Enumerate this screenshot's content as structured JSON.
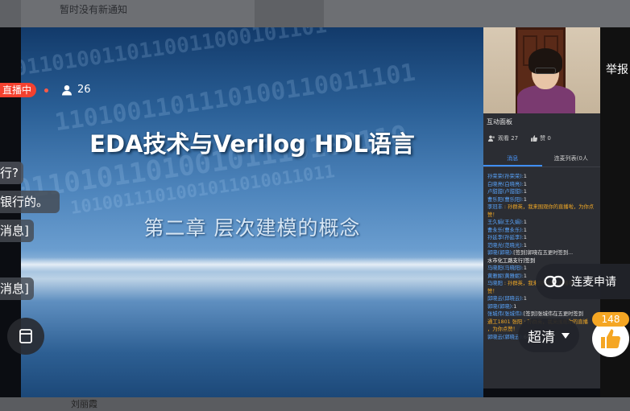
{
  "background": {
    "notice": "暂时没有新通知",
    "bottom_user": "刘丽霞"
  },
  "slide": {
    "title": "EDA技术与Verilog HDL语言",
    "subtitle": "第二章  层次建模的概念"
  },
  "live": {
    "status": "直播中",
    "viewers": "26"
  },
  "chat_bubbles": [
    "行?",
    "银行的。",
    "消息]",
    "消息]"
  ],
  "panel": {
    "title": "互动面板",
    "viewers": "观看 27",
    "likes": "赞 0",
    "tabs": [
      "消息",
      "连麦列表(0人"
    ],
    "messages": [
      {
        "name": "孙荣荣(孙荣荣):",
        "text": "1"
      },
      {
        "name": "白晓亮(白晓亮):",
        "text": "1"
      },
      {
        "name": "卢甜甜(卢甜甜):",
        "text": "1"
      },
      {
        "name": "曹乐阳(曹乐阳):",
        "text": "1"
      },
      {
        "name": "李冠丰 ",
        "text": ": 孙群英，我来围观你的直播啦，为你点",
        "sys": true
      },
      {
        "name": "",
        "text": "赞！",
        "sys": true
      },
      {
        "name": "王久娟(王久娟):",
        "text": "1"
      },
      {
        "name": "曹永乐(曹永乐):",
        "text": "1"
      },
      {
        "name": "孙延李(孙延李):",
        "text": "1"
      },
      {
        "name": "范晓光(范晓光):",
        "text": "1"
      },
      {
        "name": "郭晓(郭晓):",
        "text": "[签到]郭晓在五更时签到..."
      },
      {
        "name": "",
        "text": "水市化工路支行]签到",
        "w": true
      },
      {
        "name": "马晓阳(马晓阳):",
        "text": "1"
      },
      {
        "name": "黄雅妮(黄雅妮):",
        "text": "1"
      },
      {
        "name": "马晓阳 ",
        "text": ": 孙群英，我来围观你的直播啦",
        "sys": true
      },
      {
        "name": "",
        "text": "赞！",
        "sys": true
      },
      {
        "name": "邱晓云(邱晓云):",
        "text": "1"
      },
      {
        "name": "郭晓(郭晓):",
        "text": "1"
      },
      {
        "name": "张城伟(张城伟):",
        "text": "[签到]张城伟在五更时签到"
      },
      {
        "name": "",
        "text": "通工1801 张阳 : 孙群英，我来围观你的直播",
        "sys": true
      },
      {
        "name": "",
        "text": "，为你点赞！",
        "sys": true
      },
      {
        "name": "郭晓云(郭晓云):",
        "text": "666"
      }
    ]
  },
  "controls": {
    "report": "举报",
    "lianmai": "连麦申请",
    "quality": "超清",
    "like_count": "148"
  }
}
